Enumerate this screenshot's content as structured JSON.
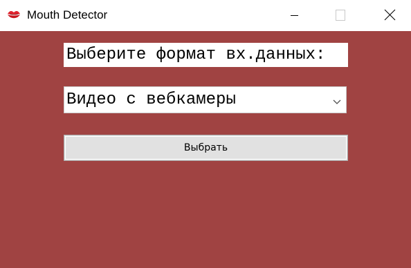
{
  "window": {
    "title": "Mouth Detector",
    "icon": "lips-icon",
    "controls": [
      "minimize-icon",
      "maximize-icon",
      "close-icon"
    ]
  },
  "form": {
    "prompt": "Выберите формат вх.данных:",
    "input_source": {
      "selected": "Видео с вебкамеры"
    },
    "submit_label": "Выбрать"
  },
  "colors": {
    "background": "#a04342",
    "titlebar": "#ffffff",
    "lips": "#e0232e",
    "button_face": "#e1e1e1"
  }
}
